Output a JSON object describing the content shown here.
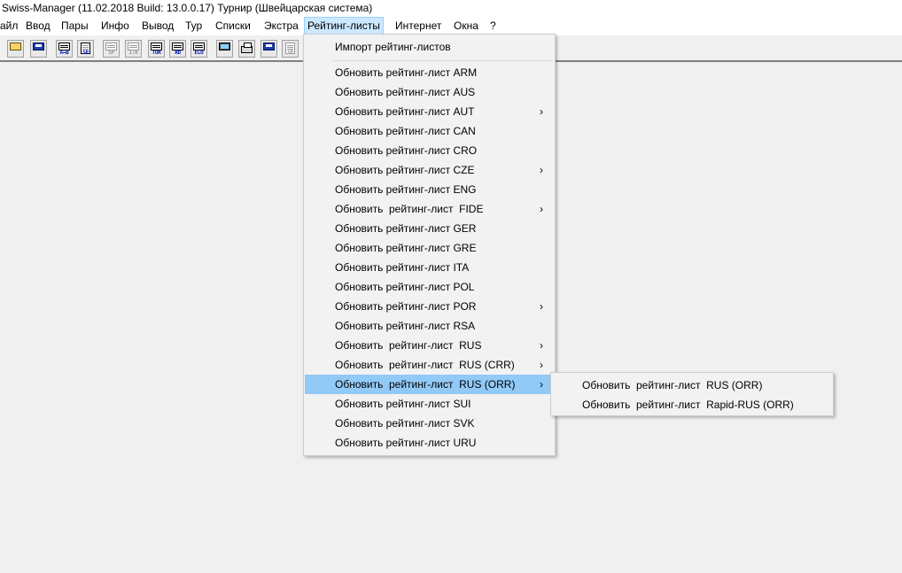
{
  "window": {
    "title": "Swiss-Manager (11.02.2018 Build: 13.0.0.17)  Турнир    (Швейцарская система)"
  },
  "menubar": {
    "items": [
      "айл",
      "Ввод",
      "Пары",
      "Инфо",
      "Вывод",
      "Тур",
      "Списки",
      "Экстра",
      "Рейтинг-листы",
      "Интернет",
      "Окна",
      "?"
    ],
    "active_index": 8
  },
  "toolbar": {
    "buttons": [
      {
        "icon": "open-folder-icon",
        "label": ""
      },
      {
        "icon": "save-disk-icon",
        "label": ""
      },
      {
        "icon": "pairing-a-b-icon",
        "label": "A↔B"
      },
      {
        "icon": "starting-rank-icon",
        "label": "SP"
      },
      {
        "icon": "sp-disabled-icon",
        "label": "SP"
      },
      {
        "icon": "score-disabled-icon",
        "label": "1:0"
      },
      {
        "icon": "tournament-icon",
        "label": "TUR"
      },
      {
        "icon": "round-icon",
        "label": "RD"
      },
      {
        "icon": "elo-icon",
        "label": "ELO"
      },
      {
        "icon": "screen-icon",
        "label": ""
      },
      {
        "icon": "print-icon",
        "label": ""
      },
      {
        "icon": "save-disk-icon",
        "label": ""
      },
      {
        "icon": "sp-doc-disabled-icon",
        "label": "SP"
      }
    ]
  },
  "rating_menu": {
    "items": [
      {
        "label": "Импорт рейтинг-листов",
        "submenu": false
      },
      {
        "separator": true
      },
      {
        "label": "Обновить рейтинг-лист ARM",
        "submenu": false
      },
      {
        "label": "Обновить рейтинг-лист AUS",
        "submenu": false
      },
      {
        "label": "Обновить рейтинг-лист AUT",
        "submenu": true
      },
      {
        "label": "Обновить рейтинг-лист CAN",
        "submenu": false
      },
      {
        "label": "Обновить рейтинг-лист CRO",
        "submenu": false
      },
      {
        "label": "Обновить рейтинг-лист CZE",
        "submenu": true
      },
      {
        "label": "Обновить рейтинг-лист ENG",
        "submenu": false
      },
      {
        "label": "Обновить  рейтинг-лист  FIDE",
        "submenu": true
      },
      {
        "label": "Обновить рейтинг-лист GER",
        "submenu": false
      },
      {
        "label": "Обновить рейтинг-лист GRE",
        "submenu": false
      },
      {
        "label": "Обновить рейтинг-лист ITA",
        "submenu": false
      },
      {
        "label": "Обновить рейтинг-лист POL",
        "submenu": false
      },
      {
        "label": "Обновить рейтинг-лист POR",
        "submenu": true
      },
      {
        "label": "Обновить рейтинг-лист RSA",
        "submenu": false
      },
      {
        "label": "Обновить  рейтинг-лист  RUS",
        "submenu": true
      },
      {
        "label": "Обновить  рейтинг-лист  RUS (CRR)",
        "submenu": true
      },
      {
        "label": "Обновить  рейтинг-лист  RUS (ORR)",
        "submenu": true,
        "highlighted": true
      },
      {
        "label": "Обновить рейтинг-лист SUI",
        "submenu": false
      },
      {
        "label": "Обновить рейтинг-лист SVK",
        "submenu": false
      },
      {
        "label": "Обновить рейтинг-лист URU",
        "submenu": false
      }
    ]
  },
  "rus_orr_submenu": {
    "items": [
      "Обновить  рейтинг-лист  RUS (ORR)",
      "Обновить  рейтинг-лист  Rapid-RUS (ORR)"
    ]
  },
  "colors": {
    "background": "#f0f0f0",
    "menu_highlight": "#91c9f7",
    "menubar_active": "#cce8ff"
  }
}
